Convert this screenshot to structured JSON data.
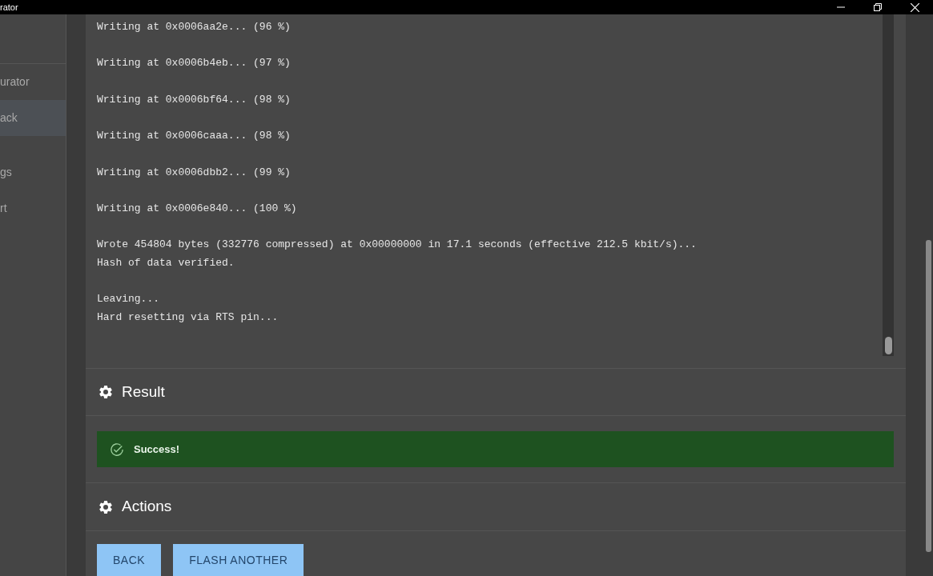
{
  "window": {
    "title": "rator"
  },
  "sidebar": {
    "items": [
      {
        "label": "urator",
        "selected": false
      },
      {
        "label": "ack",
        "selected": true
      },
      {
        "label": "gs",
        "selected": false
      },
      {
        "label": "rt",
        "selected": false
      }
    ]
  },
  "log": {
    "blocks": [
      [
        "Writing at 0x0006aa2e... (96 %)"
      ],
      [
        "Writing at 0x0006b4eb... (97 %)"
      ],
      [
        "Writing at 0x0006bf64... (98 %)"
      ],
      [
        "Writing at 0x0006caaa... (98 %)"
      ],
      [
        "Writing at 0x0006dbb2... (99 %)"
      ],
      [
        "Writing at 0x0006e840... (100 %)"
      ],
      [
        "Wrote 454804 bytes (332776 compressed) at 0x00000000 in 17.1 seconds (effective 212.5 kbit/s)...",
        "Hash of data verified."
      ],
      [
        "Leaving...",
        "Hard resetting via RTS pin..."
      ]
    ]
  },
  "result": {
    "title": "Result",
    "alert": {
      "kind": "success",
      "text": "Success!"
    }
  },
  "actions": {
    "title": "Actions",
    "buttons": [
      "BACK",
      "FLASH ANOTHER"
    ]
  }
}
